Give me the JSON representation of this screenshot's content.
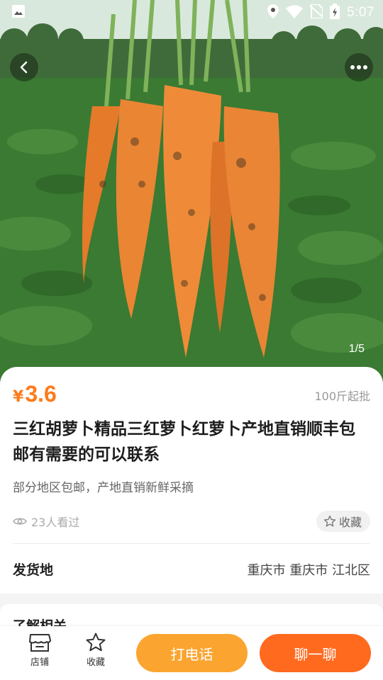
{
  "status_bar": {
    "time": "5:07"
  },
  "image": {
    "alt": "carrots-photo",
    "counter": "1/5"
  },
  "product": {
    "currency": "¥",
    "price": "3.6",
    "moq": "100斤起批",
    "title": "三红胡萝卜精品三红萝卜红萝卜产地直销顺丰包邮有需要的可以联系",
    "subtitle": "部分地区包邮，产地直销新鲜采摘",
    "views": "23人看过",
    "favorite_label": "收藏"
  },
  "shipping": {
    "label": "发货地",
    "value": "重庆市 重庆市 江北区"
  },
  "section2": {
    "header": "了解相关"
  },
  "bottom_bar": {
    "shop_label": "店铺",
    "fav_label": "收藏",
    "call_label": "打电话",
    "chat_label": "聊一聊"
  },
  "colors": {
    "accent": "#ff7a1a",
    "call": "#fba530",
    "chat": "#ff6a1f"
  }
}
